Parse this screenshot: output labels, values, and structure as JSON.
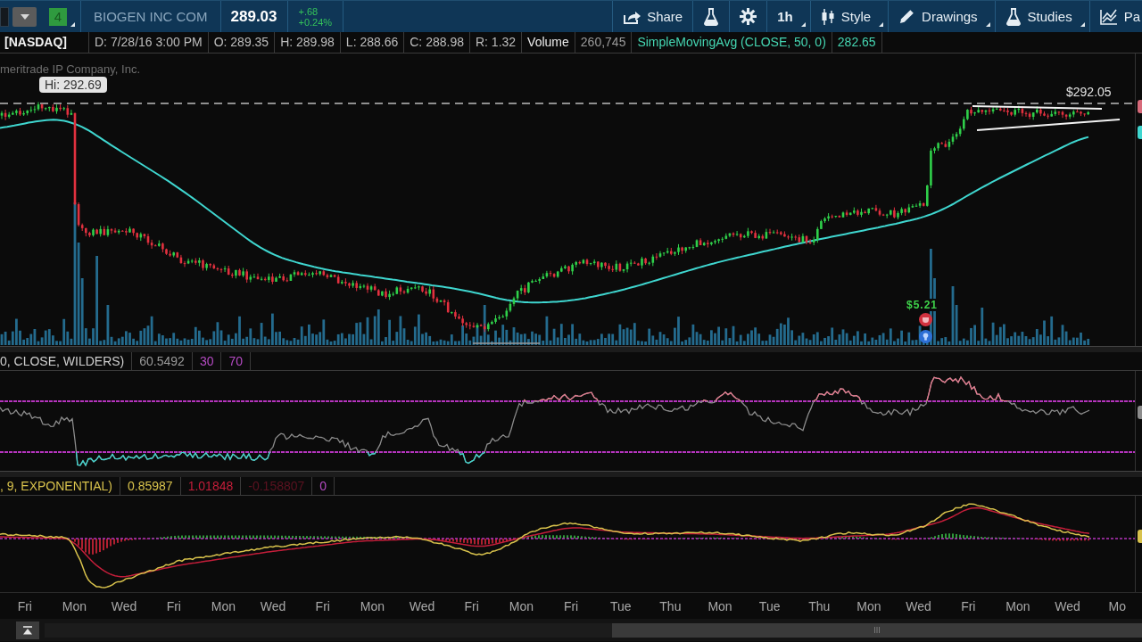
{
  "toolbar": {
    "link_badge": "4",
    "instrument": "BIOGEN INC COM",
    "last_price": "289.03",
    "change": "+.68",
    "change_percent": "+0.24%",
    "buttons": [
      {
        "kind": "share",
        "label": "Share",
        "dropdown": false
      },
      {
        "kind": "flask",
        "dropdown": false
      },
      {
        "kind": "gear",
        "dropdown": false
      },
      {
        "kind": "interval",
        "label": "1h",
        "dropdown": true
      },
      {
        "kind": "style",
        "label": "Style",
        "dropdown": true
      },
      {
        "kind": "drawings",
        "label": "Drawings",
        "dropdown": true
      },
      {
        "kind": "studies",
        "label": "Studies",
        "dropdown": true
      },
      {
        "kind": "pattern",
        "label": "Pa",
        "dropdown": false
      }
    ]
  },
  "quote_bar": [
    {
      "kind": "exchange",
      "text": "[NASDAQ]"
    },
    {
      "kind": "quote",
      "text": "D: 7/28/16 3:00 PM"
    },
    {
      "kind": "quote",
      "text": "O: 289.35"
    },
    {
      "kind": "quote",
      "text": "H: 289.98"
    },
    {
      "kind": "quote",
      "text": "L: 288.66"
    },
    {
      "kind": "quote",
      "text": "C: 288.98"
    },
    {
      "kind": "quote",
      "text": "R: 1.32"
    },
    {
      "kind": "volume_label",
      "text": "Volume"
    },
    {
      "kind": "volume",
      "text": "260,745"
    },
    {
      "kind": "study",
      "text": "SimpleMovingAvg (CLOSE, 50, 0)"
    },
    {
      "kind": "study_value",
      "text": "282.65"
    }
  ],
  "price_pane": {
    "copyright": "meritrade IP Company, Inc.",
    "high_callout": "Hi: 292.69",
    "price_line_label": "$292.05",
    "event_label": "$5.21"
  },
  "rsi_pane": {
    "header": [
      {
        "text": "0, CLOSE, WILDERS)",
        "color": "#cfcfcf"
      },
      {
        "text": "60.5492",
        "color": "#9a9a9a"
      },
      {
        "text": "30",
        "color": "#b64bc4"
      },
      {
        "text": "70",
        "color": "#b64bc4"
      }
    ]
  },
  "macd_pane": {
    "header": [
      {
        "text": ", 9, EXPONENTIAL)",
        "color": "#d8c24c"
      },
      {
        "text": "0.85987",
        "color": "#d8c24c"
      },
      {
        "text": "1.01848",
        "color": "#c41e3a"
      },
      {
        "text": "-0.158807",
        "color": "#5c1220"
      },
      {
        "text": "0",
        "color": "#b64bc4"
      }
    ]
  },
  "x_axis": {
    "labels": [
      "Fri",
      "Mon",
      "Wed",
      "Fri",
      "Mon",
      "Wed",
      "Fri",
      "Mon",
      "Wed",
      "Fri",
      "Mon",
      "Fri",
      "Tue",
      "Thu",
      "Mon",
      "Tue",
      "Thu",
      "Mon",
      "Wed",
      "Fri",
      "Mon",
      "Wed",
      "Mo"
    ]
  }
}
